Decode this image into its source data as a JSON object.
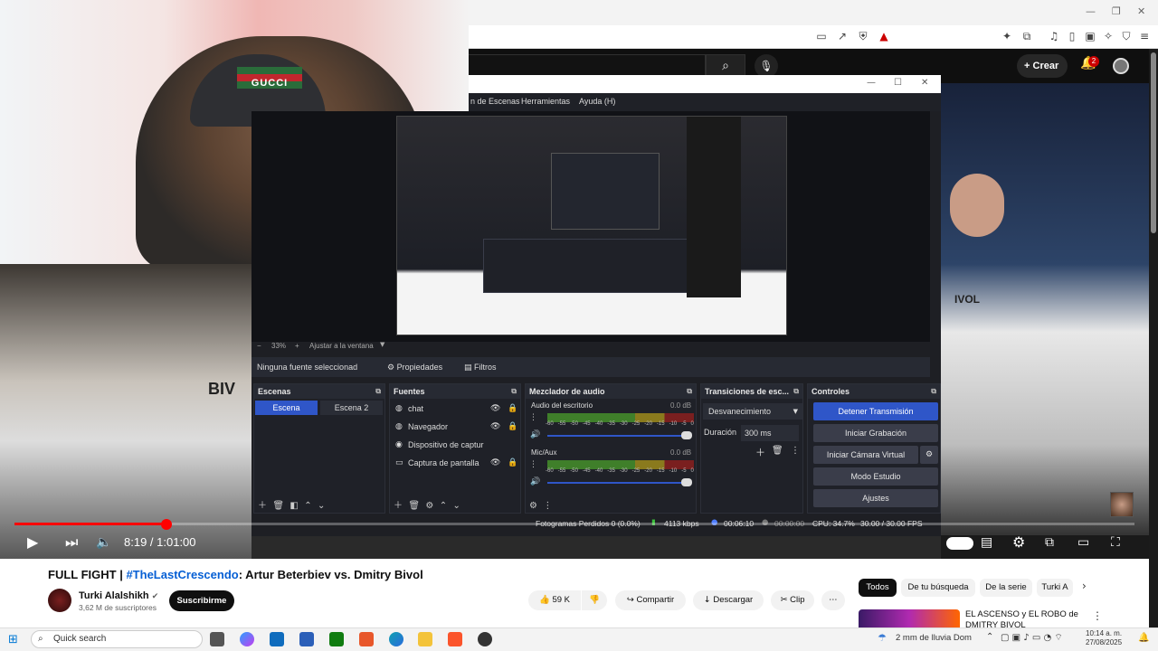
{
  "youtube": {
    "create_label": "Crear",
    "notification_count": "2",
    "video": {
      "title_prefix": "FULL FIGHT | ",
      "title_tag": "#TheLastCrescendo",
      "title_suffix": ": Artur Beterbiev vs. Dmitry Bivol",
      "time": "8:19 / 1:01:00",
      "progress_fraction": 0.136
    },
    "channel": {
      "name": "Turki Alalshikh",
      "subscribers": "3,62 M de suscriptores",
      "subscribe_label": "Suscribirme"
    },
    "actions": {
      "likes": "59 K",
      "share": "Compartir",
      "download": "Descargar",
      "clip": "Clip"
    },
    "chips": [
      "Todos",
      "De tu búsqueda",
      "De la serie",
      "Turki A"
    ],
    "recommendation": {
      "title": "EL ASCENSO y EL ROBO de DMITRY BIVOL"
    }
  },
  "cam": {
    "hat_text": "GUCCI"
  },
  "obs": {
    "menu": [
      "n de Escenas",
      "Herramientas",
      "Ayuda (H)"
    ],
    "zoom": "33%",
    "fit_label": "Ajustar a la ventana",
    "no_source": "Ninguna fuente seleccionad",
    "properties": "Propiedades",
    "filters": "Filtros",
    "scenes": {
      "title": "Escenas",
      "items": [
        "Escena",
        "Escena 2"
      ]
    },
    "sources": {
      "title": "Fuentes",
      "items": [
        "chat",
        "Navegador",
        "Dispositivo de captur",
        "Captura de pantalla"
      ]
    },
    "mixer": {
      "title": "Mezclador de audio",
      "channels": [
        {
          "name": "Audio del escritorio",
          "db": "0.0 dB"
        },
        {
          "name": "Mic/Aux",
          "db": "0.0 dB"
        }
      ],
      "scale": [
        "-60",
        "-55",
        "-50",
        "-45",
        "-40",
        "-35",
        "-30",
        "-25",
        "-20",
        "-15",
        "-10",
        "-5",
        "0"
      ]
    },
    "transitions": {
      "title": "Transiciones de esc...",
      "selected": "Desvanecimiento",
      "duration_label": "Duración",
      "duration_value": "300 ms"
    },
    "controls": {
      "title": "Controles",
      "stop_stream": "Detener Transmisión",
      "start_recording": "Iniciar Grabación",
      "virtual_cam": "Iniciar Cámara Virtual",
      "studio_mode": "Modo Estudio",
      "settings": "Ajustes"
    },
    "status": {
      "dropped": "Fotogramas Perdidos 0 (0.0%)",
      "kbps": "4113 kbps",
      "stream_time": "00:06:10",
      "rec_time": "00:00:00",
      "cpu": "CPU: 34.7%",
      "fps": "30.00 / 30.00 FPS"
    }
  },
  "taskbar": {
    "search_placeholder": "Quick search",
    "weather": "2 mm de lluvia Dom",
    "time": "10:14 a. m.",
    "date": "27/08/2025"
  },
  "colors": {
    "accent_blue": "#2f56c8",
    "yt_red": "#ff0000"
  }
}
